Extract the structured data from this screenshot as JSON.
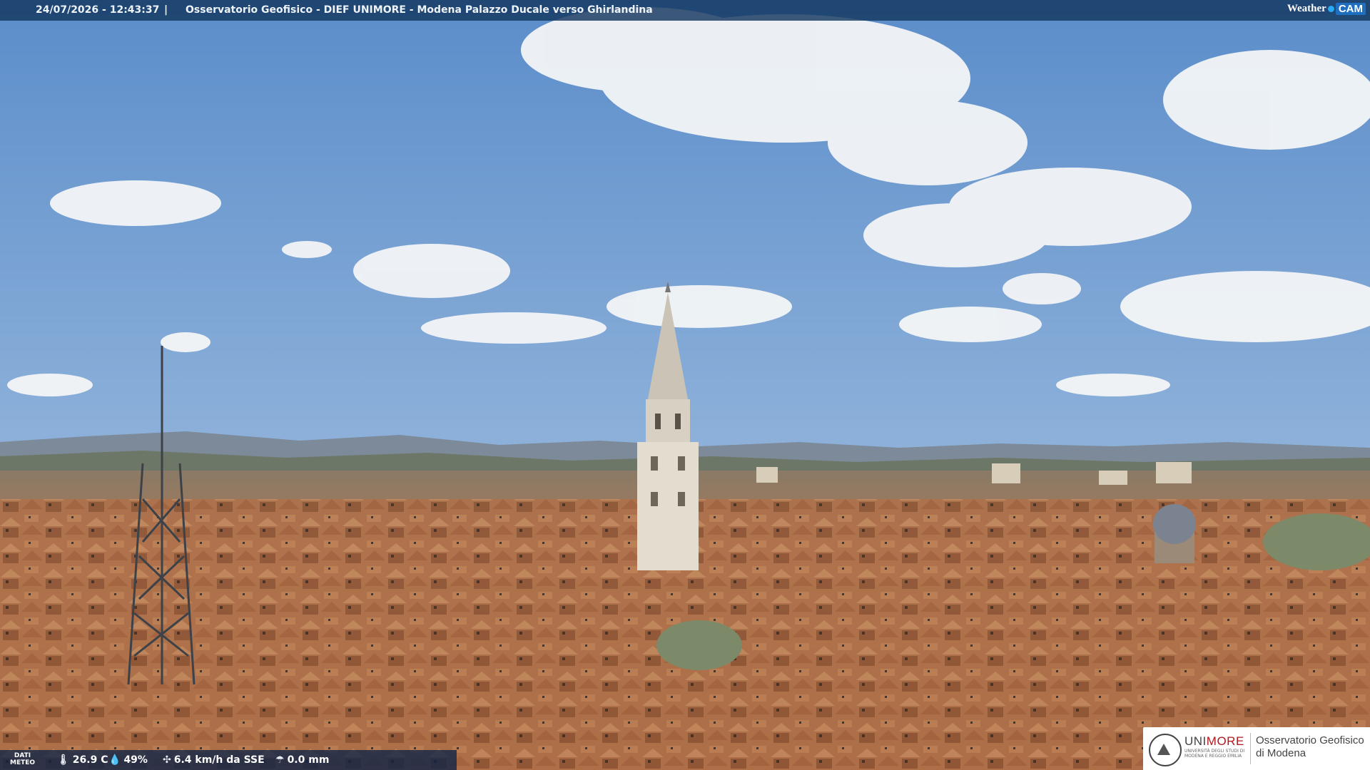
{
  "overlay": {
    "datetime": "24/07/2026 - 12:43:37",
    "separator": "|",
    "title": "Osservatorio Geofisico - DIEF UNIMORE - Modena Palazzo Ducale verso Ghirlandina",
    "brand_weather": "Weather",
    "brand_cam": "CAM"
  },
  "meteo": {
    "label_line1": "DATI",
    "label_line2": "METEO",
    "temperature": "26.9 C",
    "humidity": "49%",
    "wind": "6.4 km/h da SSE",
    "rain": "0.0 mm",
    "icons": [
      "thermometer-icon",
      "humidity-drop-icon",
      "wind-icon",
      "rain-gauge-icon"
    ]
  },
  "logo": {
    "uni_prefix": "UNI",
    "uni_suffix": "MORE",
    "uni_sub": "UNIVERSITÀ DEGLI STUDI DI MODENA E REGGIO EMILIA",
    "obs_line1": "Osservatorio Geofisico",
    "obs_line2": "di Modena"
  },
  "colors": {
    "sky_top": "#5f8fcb",
    "sky_bottom": "#b9cfe3",
    "roof": "#b7764b",
    "tower": "#e2dccf",
    "bar": "#14375f"
  }
}
